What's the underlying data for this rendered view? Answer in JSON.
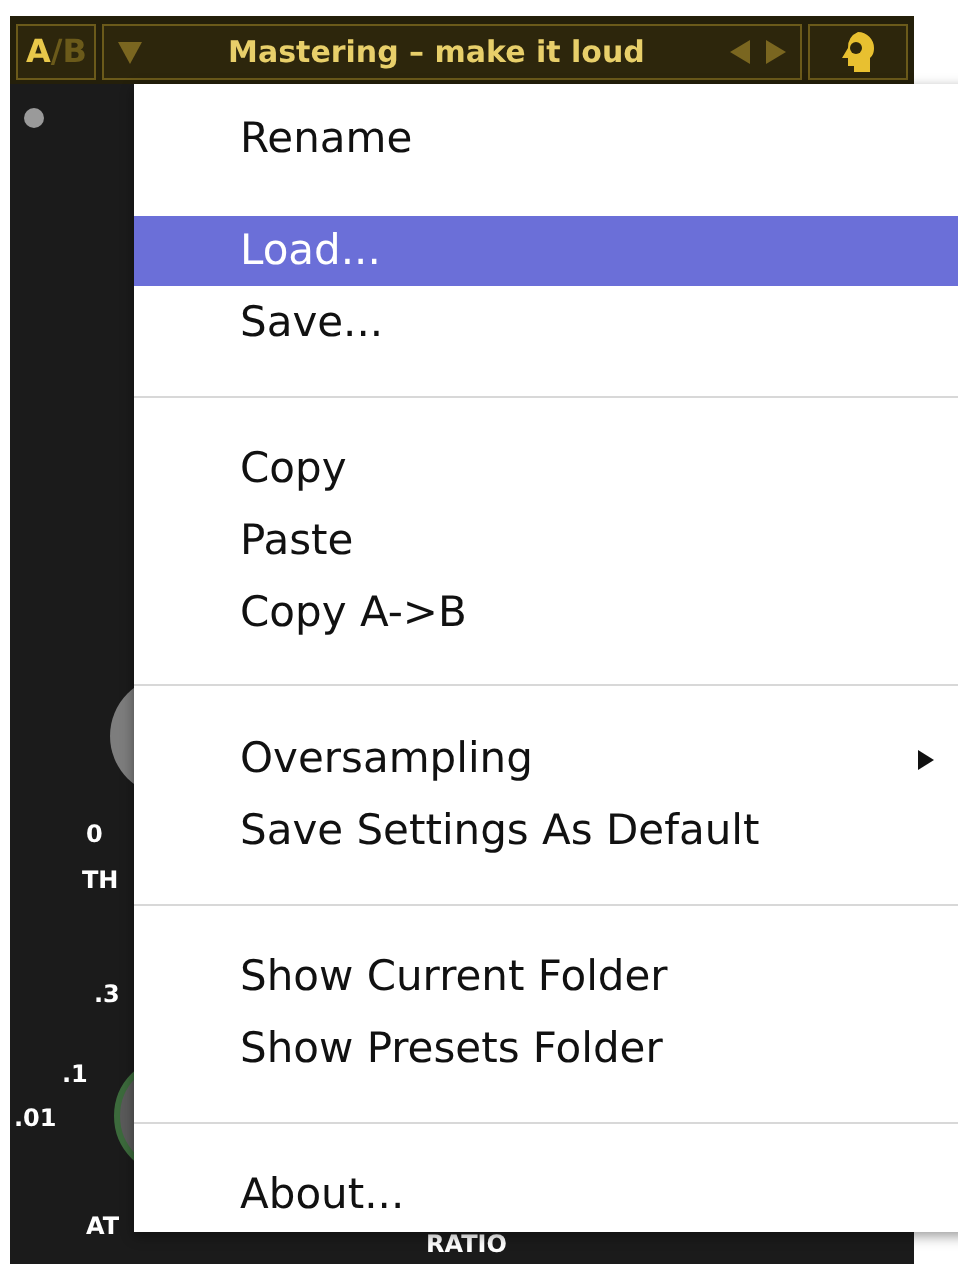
{
  "header": {
    "ab": {
      "a": "A",
      "divider": "/",
      "b": "B"
    },
    "preset": "Mastering – make it loud"
  },
  "scale_labels": [
    {
      "text": "0",
      "kind": "tick"
    },
    {
      "text": "TH",
      "kind": "label"
    },
    {
      "text": ".3",
      "kind": "tick"
    },
    {
      "text": ".1",
      "kind": "tick"
    },
    {
      "text": ".01",
      "kind": "tick"
    },
    {
      "text": "AT",
      "kind": "label"
    },
    {
      "text": "RATIO",
      "kind": "label"
    }
  ],
  "menu": [
    {
      "kind": "item",
      "label": "Rename",
      "selected": false
    },
    {
      "kind": "item",
      "label": "Load...",
      "selected": true
    },
    {
      "kind": "item",
      "label": "Save...",
      "selected": false
    },
    {
      "kind": "separator"
    },
    {
      "kind": "item",
      "label": "Copy",
      "selected": false
    },
    {
      "kind": "item",
      "label": "Paste",
      "selected": false
    },
    {
      "kind": "item",
      "label": "Copy A->B",
      "selected": false
    },
    {
      "kind": "separator"
    },
    {
      "kind": "submenu",
      "label": "Oversampling",
      "selected": false
    },
    {
      "kind": "item",
      "label": "Save Settings As Default",
      "selected": false
    },
    {
      "kind": "separator"
    },
    {
      "kind": "item",
      "label": "Show Current Folder",
      "selected": false
    },
    {
      "kind": "item",
      "label": "Show Presets Folder",
      "selected": false
    },
    {
      "kind": "separator"
    },
    {
      "kind": "item",
      "label": "About...",
      "selected": false
    }
  ]
}
